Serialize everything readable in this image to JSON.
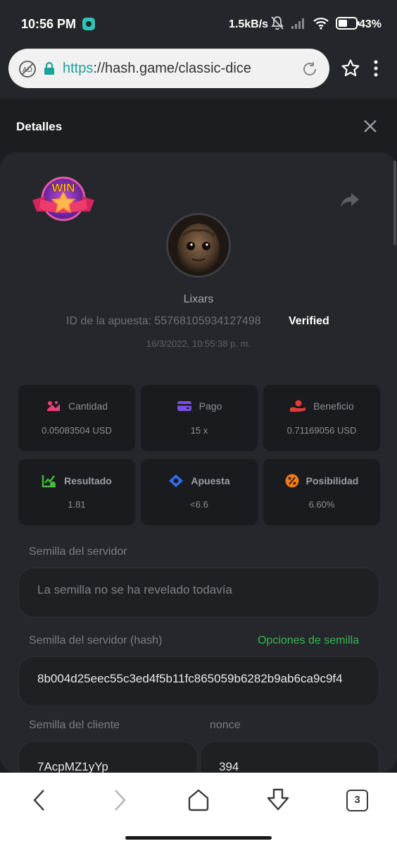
{
  "status_bar": {
    "time": "10:56 PM",
    "speed": "1.5kB/s",
    "battery": "43%",
    "icons": [
      "app-icon",
      "mute-bell-icon",
      "signal-icon",
      "wifi-icon",
      "battery-icon"
    ]
  },
  "browser": {
    "url_protocol": "https",
    "url_rest": "://hash.game/classic-dice",
    "icons": [
      "adblock-icon",
      "lock-icon",
      "reload-icon",
      "star-icon",
      "more-icon"
    ]
  },
  "header": {
    "title": "Detalles"
  },
  "bet": {
    "badge": "WIN",
    "username": "Lixars",
    "bet_id": "ID de la apuesta: 55768105934127498",
    "verified": "Verified",
    "date": "16/3/2022, 10:55:38 p. m."
  },
  "stats": [
    {
      "label": "Cantidad",
      "value": "0.05083504 USD",
      "icon": "coins-icon",
      "color": "#e8417a"
    },
    {
      "label": "Pago",
      "value": "15 x",
      "icon": "wallet-icon",
      "color": "#7a4df0"
    },
    {
      "label": "Beneficio",
      "value": "0.71169056 USD",
      "icon": "profit-hand-icon",
      "color": "#e23b3b"
    },
    {
      "label": "Resultado",
      "value": "1.81",
      "icon": "chart-check-icon",
      "color": "#3fbf3a"
    },
    {
      "label": "Apuesta",
      "value": "<6.6",
      "icon": "target-tag-icon",
      "color": "#2f6ef0"
    },
    {
      "label": "Posibilidad",
      "value": "6.60%",
      "icon": "percent-icon",
      "color": "#f07a1a"
    }
  ],
  "fields": {
    "server_seed_label": "Semilla del servidor",
    "server_seed_value": "La semilla no se ha revelado todavía",
    "server_hash_label": "Semilla del servidor (hash)",
    "seed_options": "Opciones de semilla",
    "server_hash_value": "8b004d25eec55c3ed4f5b11fc865059b6282b9ab6ca9c9f4",
    "client_seed_label": "Semilla del cliente",
    "client_seed_value": "7AcpMZ1yYp",
    "nonce_label": "nonce",
    "nonce_value": "394"
  },
  "bottom_nav": {
    "tabs_count": "3"
  },
  "colors": {
    "background": "#1c1d21",
    "card": "#25272c",
    "accent_green": "#2fbf4a",
    "teal": "#1aa39a"
  }
}
